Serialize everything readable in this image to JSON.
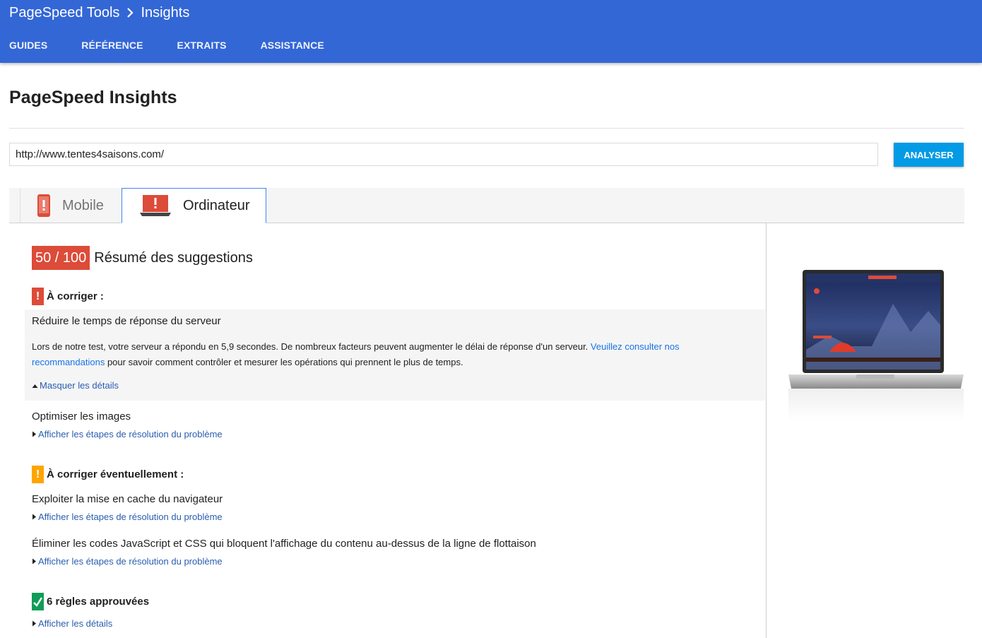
{
  "header": {
    "brand": "PageSpeed Tools",
    "current": "Insights",
    "nav": [
      "GUIDES",
      "RÉFÉRENCE",
      "EXTRAITS",
      "ASSISTANCE"
    ]
  },
  "page": {
    "title": "PageSpeed Insights"
  },
  "search": {
    "url_value": "http://www.tentes4saisons.com/",
    "analyze_label": "ANALYSER"
  },
  "tabs": [
    {
      "label": "Mobile",
      "icon": "mobile-phone-icon",
      "selected": false
    },
    {
      "label": "Ordinateur",
      "icon": "laptop-icon",
      "selected": true
    }
  ],
  "result": {
    "score": "50 / 100",
    "summary_title": "Résumé des suggestions",
    "fix": {
      "heading": "À corriger :",
      "rules": [
        {
          "title": "Réduire le temps de réponse du serveur",
          "desc_before": "Lors de notre test, votre serveur a répondu en 5,9 secondes. De nombreux facteurs peuvent augmenter le délai de réponse d'un serveur. ",
          "desc_link": "Veuillez consulter nos recommandations",
          "desc_after": " pour savoir comment contrôler et mesurer les opérations qui prennent le plus de temps.",
          "toggle": "Masquer les détails"
        },
        {
          "title": "Optimiser les images",
          "toggle": "Afficher les étapes de résolution du problème"
        }
      ]
    },
    "consider": {
      "heading": "À corriger éventuellement :",
      "rules": [
        {
          "title": "Exploiter la mise en cache du navigateur",
          "toggle": "Afficher les étapes de résolution du problème"
        },
        {
          "title": "Éliminer les codes JavaScript et CSS qui bloquent l'affichage du contenu au-dessus de la ligne de flottaison",
          "toggle": "Afficher les étapes de résolution du problème"
        }
      ]
    },
    "passed": {
      "heading": "6 règles approuvées",
      "toggle": "Afficher les détails"
    }
  },
  "colors": {
    "header_bg": "#3367d6",
    "score_red": "#dd4b39",
    "warn_orange": "#ffa400",
    "pass_green": "#0f9d58",
    "button_blue": "#039be5",
    "link_blue": "#2a5db0"
  }
}
